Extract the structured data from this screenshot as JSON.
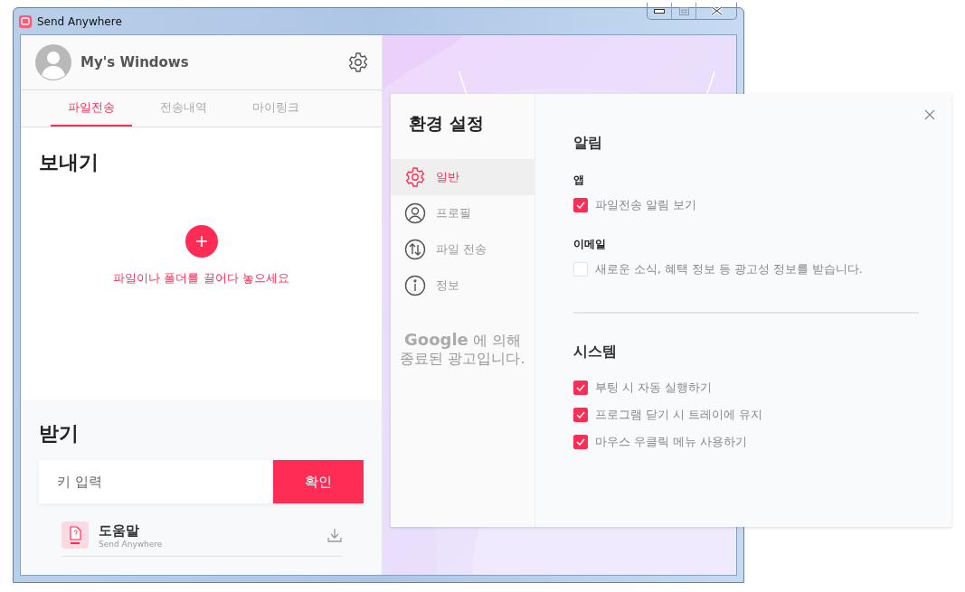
{
  "window": {
    "title": "Send Anywhere"
  },
  "profile": {
    "name": "My's Windows"
  },
  "tabs": [
    {
      "label": "파일전송",
      "selected": true
    },
    {
      "label": "전송내역",
      "selected": false
    },
    {
      "label": "마이링크",
      "selected": false
    }
  ],
  "send": {
    "title": "보내기",
    "hint": "파일이나 폴더를 끌어다 놓으세요"
  },
  "receive": {
    "title": "받기",
    "placeholder": "키 입력",
    "button": "확인"
  },
  "files": [
    {
      "name": "도움말",
      "subtitle": "Send Anywhere"
    }
  ],
  "settings": {
    "title": "환경 설정",
    "nav": [
      {
        "label": "일반",
        "selected": true
      },
      {
        "label": "프로필",
        "selected": false
      },
      {
        "label": "파일 전송",
        "selected": false
      },
      {
        "label": "정보",
        "selected": false
      }
    ],
    "ad": {
      "brand": "Google",
      "text": "에 의해 종료된 광고입니다."
    },
    "sections": [
      {
        "title": "알림",
        "groups": [
          {
            "label": "앱",
            "options": [
              {
                "label": "파일전송 알림 보기",
                "checked": true
              }
            ]
          },
          {
            "label": "이메일",
            "options": [
              {
                "label": "새로운 소식, 혜택 정보 등 광고성 정보를 받습니다.",
                "checked": false
              }
            ]
          }
        ]
      },
      {
        "title": "시스템",
        "groups": [
          {
            "options": [
              {
                "label": "부팅 시 자동 실행하기",
                "checked": true
              },
              {
                "label": "프로그램 닫기 시 트레이에 유지",
                "checked": true
              },
              {
                "label": "마우스 우클릭 메뉴 사용하기",
                "checked": true
              }
            ]
          }
        ]
      }
    ]
  }
}
